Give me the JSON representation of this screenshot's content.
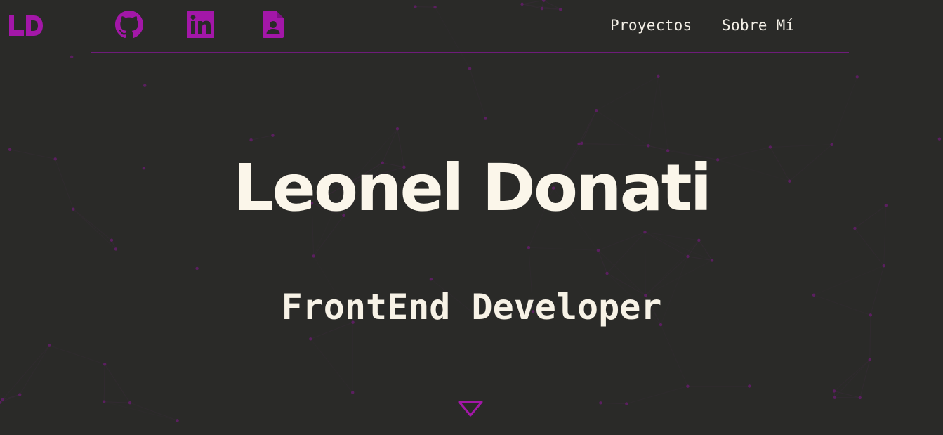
{
  "brand": {
    "logo_text": "LD",
    "accent_color": "#a317a8",
    "background_color": "#2a2a28",
    "text_color": "#fbf6ea"
  },
  "header": {
    "social_links": [
      {
        "name": "github",
        "icon": "github-icon"
      },
      {
        "name": "linkedin",
        "icon": "linkedin-icon"
      },
      {
        "name": "resume",
        "icon": "contact-card-icon"
      }
    ],
    "nav": {
      "projects_label": "Proyectos",
      "about_label": "Sobre Mí"
    }
  },
  "hero": {
    "name": "Leonel Donati",
    "role": "FrontEnd Developer",
    "scroll_icon": "chevron-down-triangle-icon"
  }
}
